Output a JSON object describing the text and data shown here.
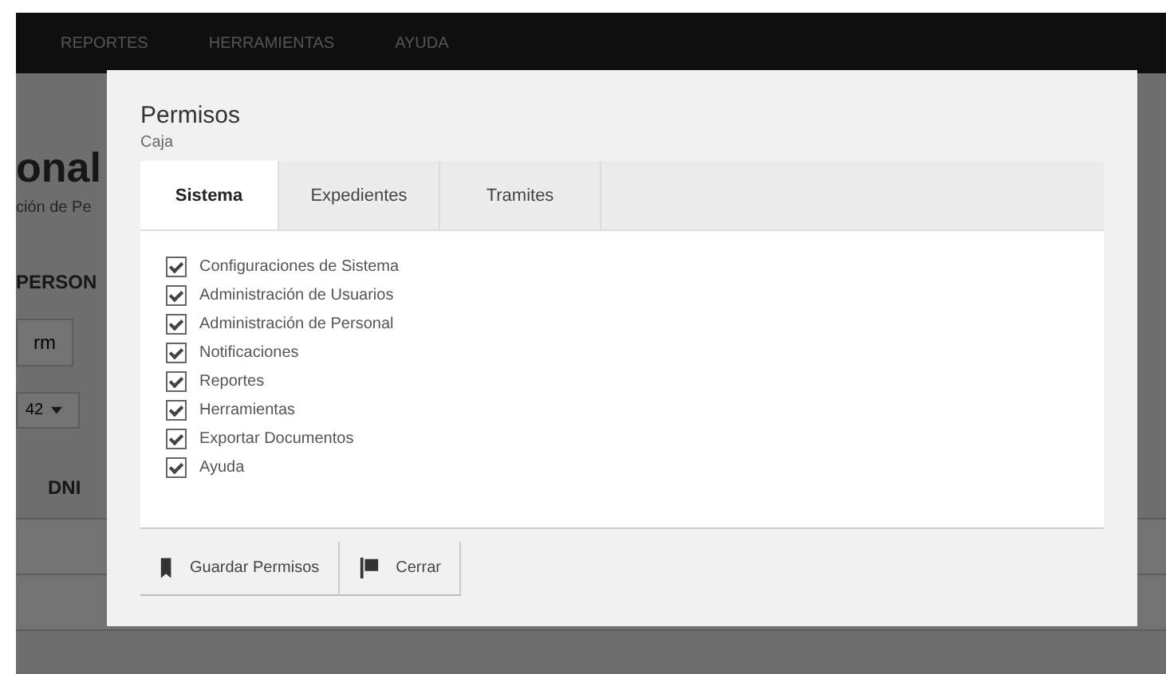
{
  "navbar": {
    "items": [
      {
        "label": "REPORTES"
      },
      {
        "label": "HERRAMIENTAS"
      },
      {
        "label": "AYUDA"
      }
    ]
  },
  "page": {
    "heading": "onal",
    "subtitle": "ción de Pe",
    "section_tab": "PERSON",
    "toolbar_button": "rm",
    "page_size": "42",
    "table": {
      "columns": [
        "DNI"
      ]
    }
  },
  "modal": {
    "title": "Permisos",
    "subtitle": "Caja",
    "tabs": [
      {
        "label": "Sistema",
        "selected": true
      },
      {
        "label": "Expedientes",
        "selected": false
      },
      {
        "label": "Tramites",
        "selected": false
      }
    ],
    "permissions": [
      {
        "label": "Configuraciones de Sistema",
        "checked": true
      },
      {
        "label": "Administración de Usuarios",
        "checked": true
      },
      {
        "label": "Administración de Personal",
        "checked": true
      },
      {
        "label": "Notificaciones",
        "checked": true
      },
      {
        "label": "Reportes",
        "checked": true
      },
      {
        "label": "Herramientas",
        "checked": true
      },
      {
        "label": "Exportar Documentos",
        "checked": true
      },
      {
        "label": "Ayuda",
        "checked": true
      }
    ],
    "buttons": [
      {
        "label": "Guardar Permisos",
        "kind": "save"
      },
      {
        "label": "Cerrar",
        "kind": "close"
      }
    ]
  }
}
